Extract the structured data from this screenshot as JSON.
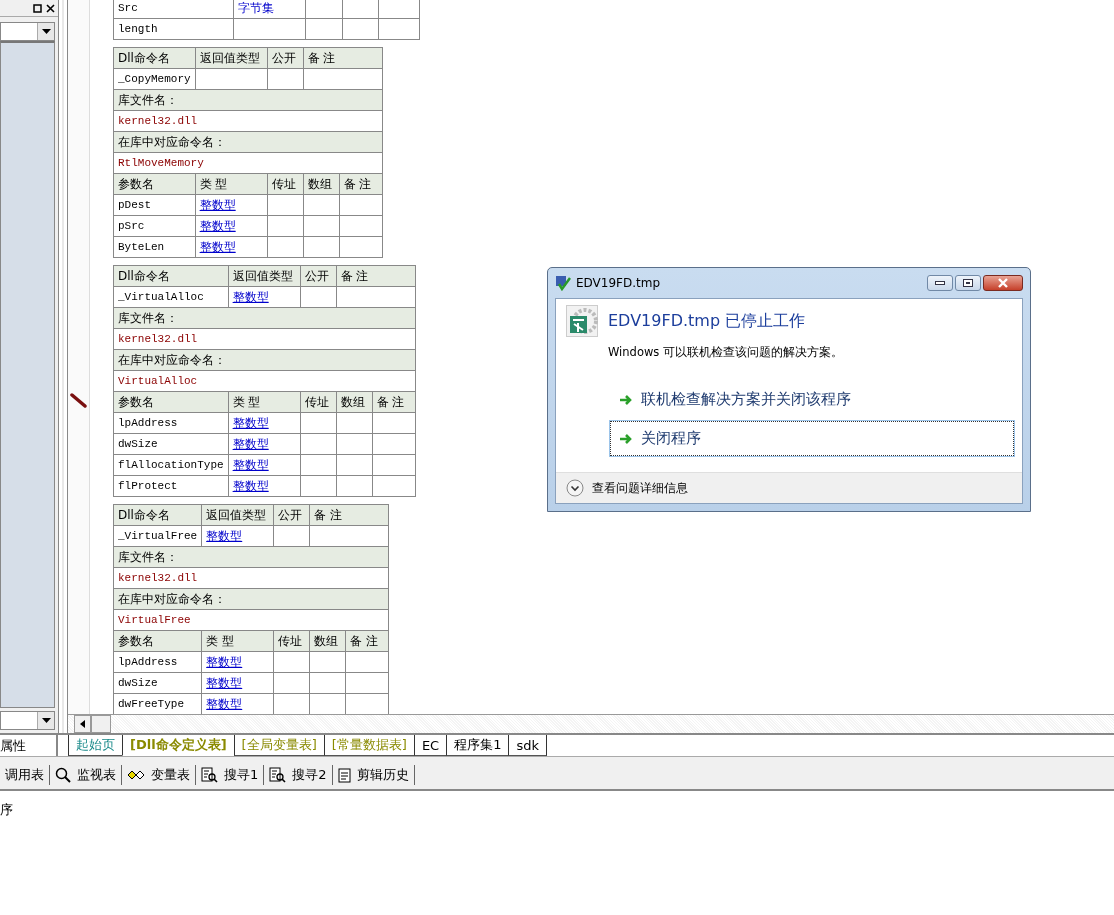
{
  "left_panel": {
    "tab": "属性"
  },
  "code_tables": [
    {
      "kind": "partial",
      "params": [
        {
          "name": "Src",
          "type": "字节集",
          "underlined": false
        },
        {
          "name": "length"
        }
      ]
    },
    {
      "kind": "dll",
      "header": [
        "Dll命令名",
        "返回值类型",
        "公开",
        "备 注"
      ],
      "name": "_CopyMemory",
      "lib_label": "库文件名：",
      "lib": "kernel32.dll",
      "entry_label": "在库中对应命令名：",
      "entry": "RtlMoveMemory",
      "param_header": [
        "参数名",
        "类 型",
        "传址",
        "数组",
        "备 注"
      ],
      "params": [
        {
          "name": "pDest",
          "type": "整数型",
          "underlined": true
        },
        {
          "name": "pSrc",
          "type": "整数型",
          "underlined": true
        },
        {
          "name": "ByteLen",
          "type": "整数型",
          "underlined": true
        }
      ]
    },
    {
      "kind": "dll",
      "header": [
        "Dll命令名",
        "返回值类型",
        "公开",
        "备 注"
      ],
      "name": "_VirtualAlloc",
      "return_type": "整数型",
      "lib_label": "库文件名：",
      "lib": "kernel32.dll",
      "entry_label": "在库中对应命令名：",
      "entry": "VirtualAlloc",
      "param_header": [
        "参数名",
        "类 型",
        "传址",
        "数组",
        "备 注"
      ],
      "params": [
        {
          "name": "lpAddress",
          "type": "整数型",
          "underlined": true
        },
        {
          "name": "dwSize",
          "type": "整数型",
          "underlined": true
        },
        {
          "name": "flAllocationType",
          "type": "整数型",
          "underlined": true
        },
        {
          "name": "flProtect",
          "type": "整数型",
          "underlined": true
        }
      ]
    },
    {
      "kind": "dll",
      "header": [
        "Dll命令名",
        "返回值类型",
        "公开",
        "备 注"
      ],
      "name": "_VirtualFree",
      "return_type": "整数型",
      "lib_label": "库文件名：",
      "lib": "kernel32.dll",
      "entry_label": "在库中对应命令名：",
      "entry": "VirtualFree",
      "param_header": [
        "参数名",
        "类 型",
        "传址",
        "数组",
        "备 注"
      ],
      "params": [
        {
          "name": "lpAddress",
          "type": "整数型",
          "underlined": true
        },
        {
          "name": "dwSize",
          "type": "整数型",
          "underlined": true
        },
        {
          "name": "dwFreeType",
          "type": "整数型",
          "underlined": true
        }
      ]
    }
  ],
  "document_tabs": [
    {
      "label": "起始页",
      "color": "#1a8a8a",
      "selected": false
    },
    {
      "label": "[Dll命令定义表]",
      "color": "#8a8a00",
      "selected": true
    },
    {
      "label": "[全局变量表]",
      "color": "#8a8a00",
      "selected": false
    },
    {
      "label": "[常量数据表]",
      "color": "#8a8a00",
      "selected": false
    },
    {
      "label": "EC",
      "color": "#000000",
      "selected": false
    },
    {
      "label": "程序集1",
      "color": "#000000",
      "selected": false
    },
    {
      "label": "sdk",
      "color": "#000000",
      "selected": false
    }
  ],
  "debug_toolbar": [
    {
      "kind": "plain",
      "label": "调用表"
    },
    {
      "kind": "magnifier",
      "label": "监视表"
    },
    {
      "kind": "glasses",
      "label": "变量表"
    },
    {
      "kind": "find",
      "label": "搜寻1"
    },
    {
      "kind": "find",
      "label": "搜寻2"
    },
    {
      "kind": "page",
      "label": "剪辑历史"
    }
  ],
  "output_panel": {
    "text": "序"
  },
  "error_dialog": {
    "title": "EDV19FD.tmp",
    "heading": "EDV19FD.tmp 已停止工作",
    "message": "Windows 可以联机检查该问题的解决方案。",
    "options": [
      {
        "label": "联机检查解决方案并关闭该程序",
        "focused": false
      },
      {
        "label": "关闭程序",
        "focused": true
      }
    ],
    "details_toggle": "查看问题详细信息"
  }
}
